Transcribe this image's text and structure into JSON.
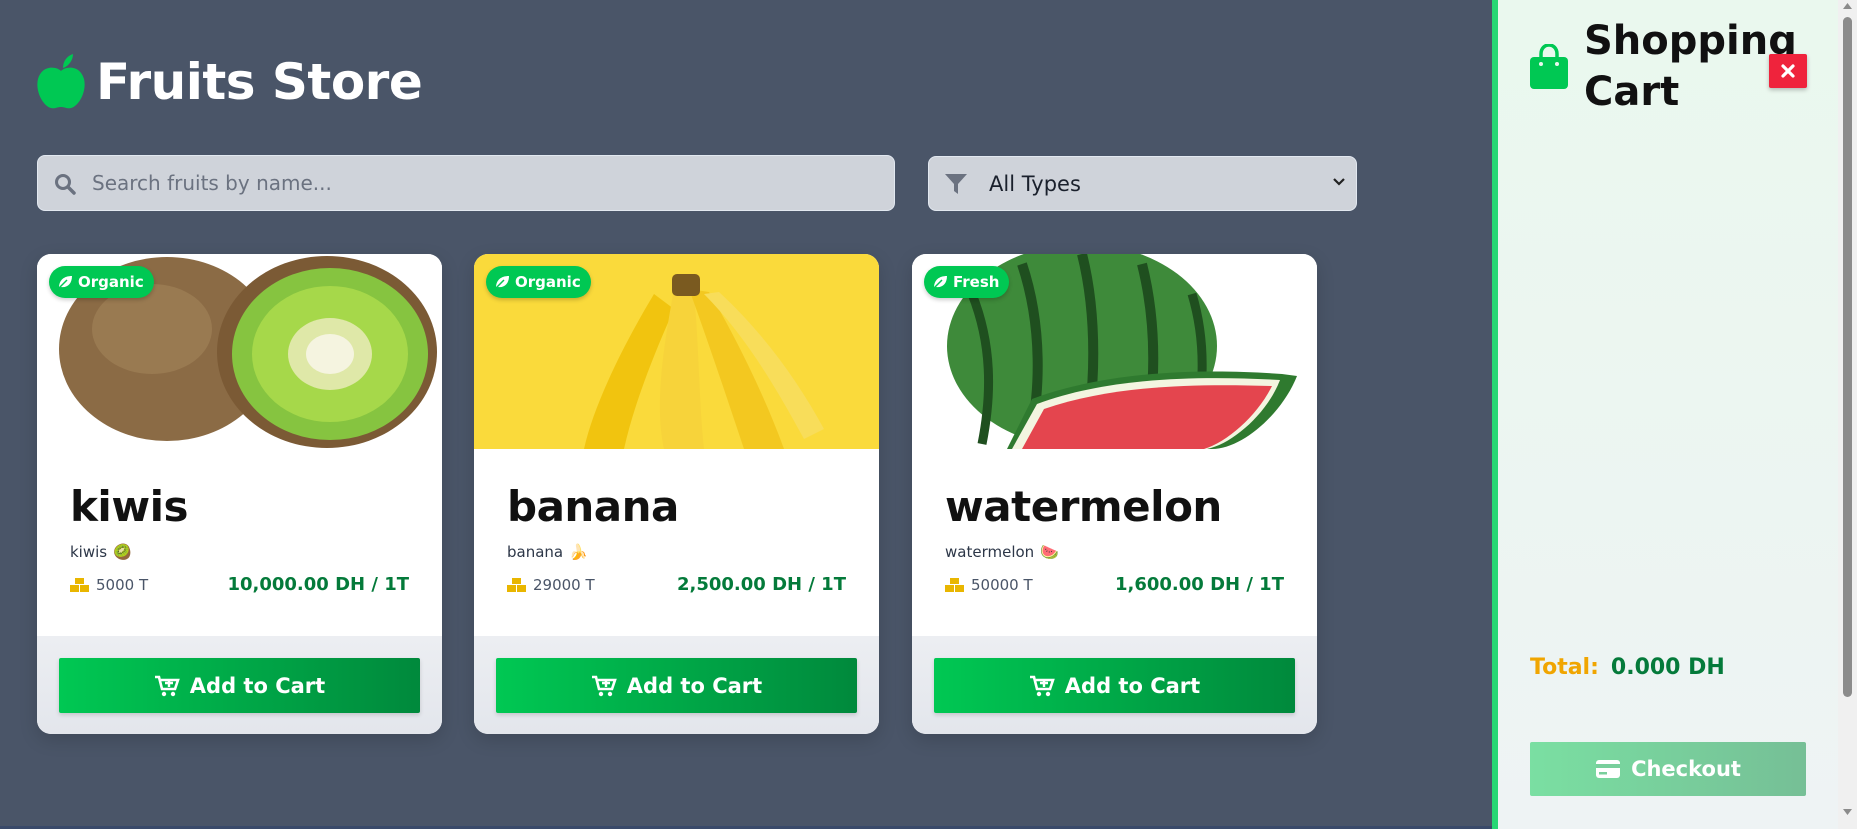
{
  "header": {
    "title": "Fruits Store",
    "logo_icon": "apple-icon"
  },
  "filters": {
    "search_placeholder": "Search fruits by name...",
    "search_value": "",
    "type_selected": "All Types"
  },
  "products": [
    {
      "name": "kiwis",
      "description": "kiwis",
      "emoji": "🥝",
      "badge": "Organic",
      "stock": "5000 T",
      "price": "10,000.00 DH / 1T",
      "button_label": "Add to Cart"
    },
    {
      "name": "banana",
      "description": "banana",
      "emoji": "🍌",
      "badge": "Organic",
      "stock": "29000 T",
      "price": "2,500.00 DH / 1T",
      "button_label": "Add to Cart"
    },
    {
      "name": "watermelon",
      "description": "watermelon",
      "emoji": "🍉",
      "badge": "Fresh",
      "stock": "50000 T",
      "price": "1,600.00 DH / 1T",
      "button_label": "Add to Cart"
    }
  ],
  "cart": {
    "title": "Shopping Cart",
    "total_label": "Total:",
    "total_value": "0.000 DH",
    "checkout_label": "Checkout"
  },
  "colors": {
    "background": "#4a5568",
    "accent_green": "#00c853",
    "price_green": "#047a3a",
    "total_label": "#f0a500",
    "close_red": "#ef233c",
    "cart_border": "#27d774"
  }
}
